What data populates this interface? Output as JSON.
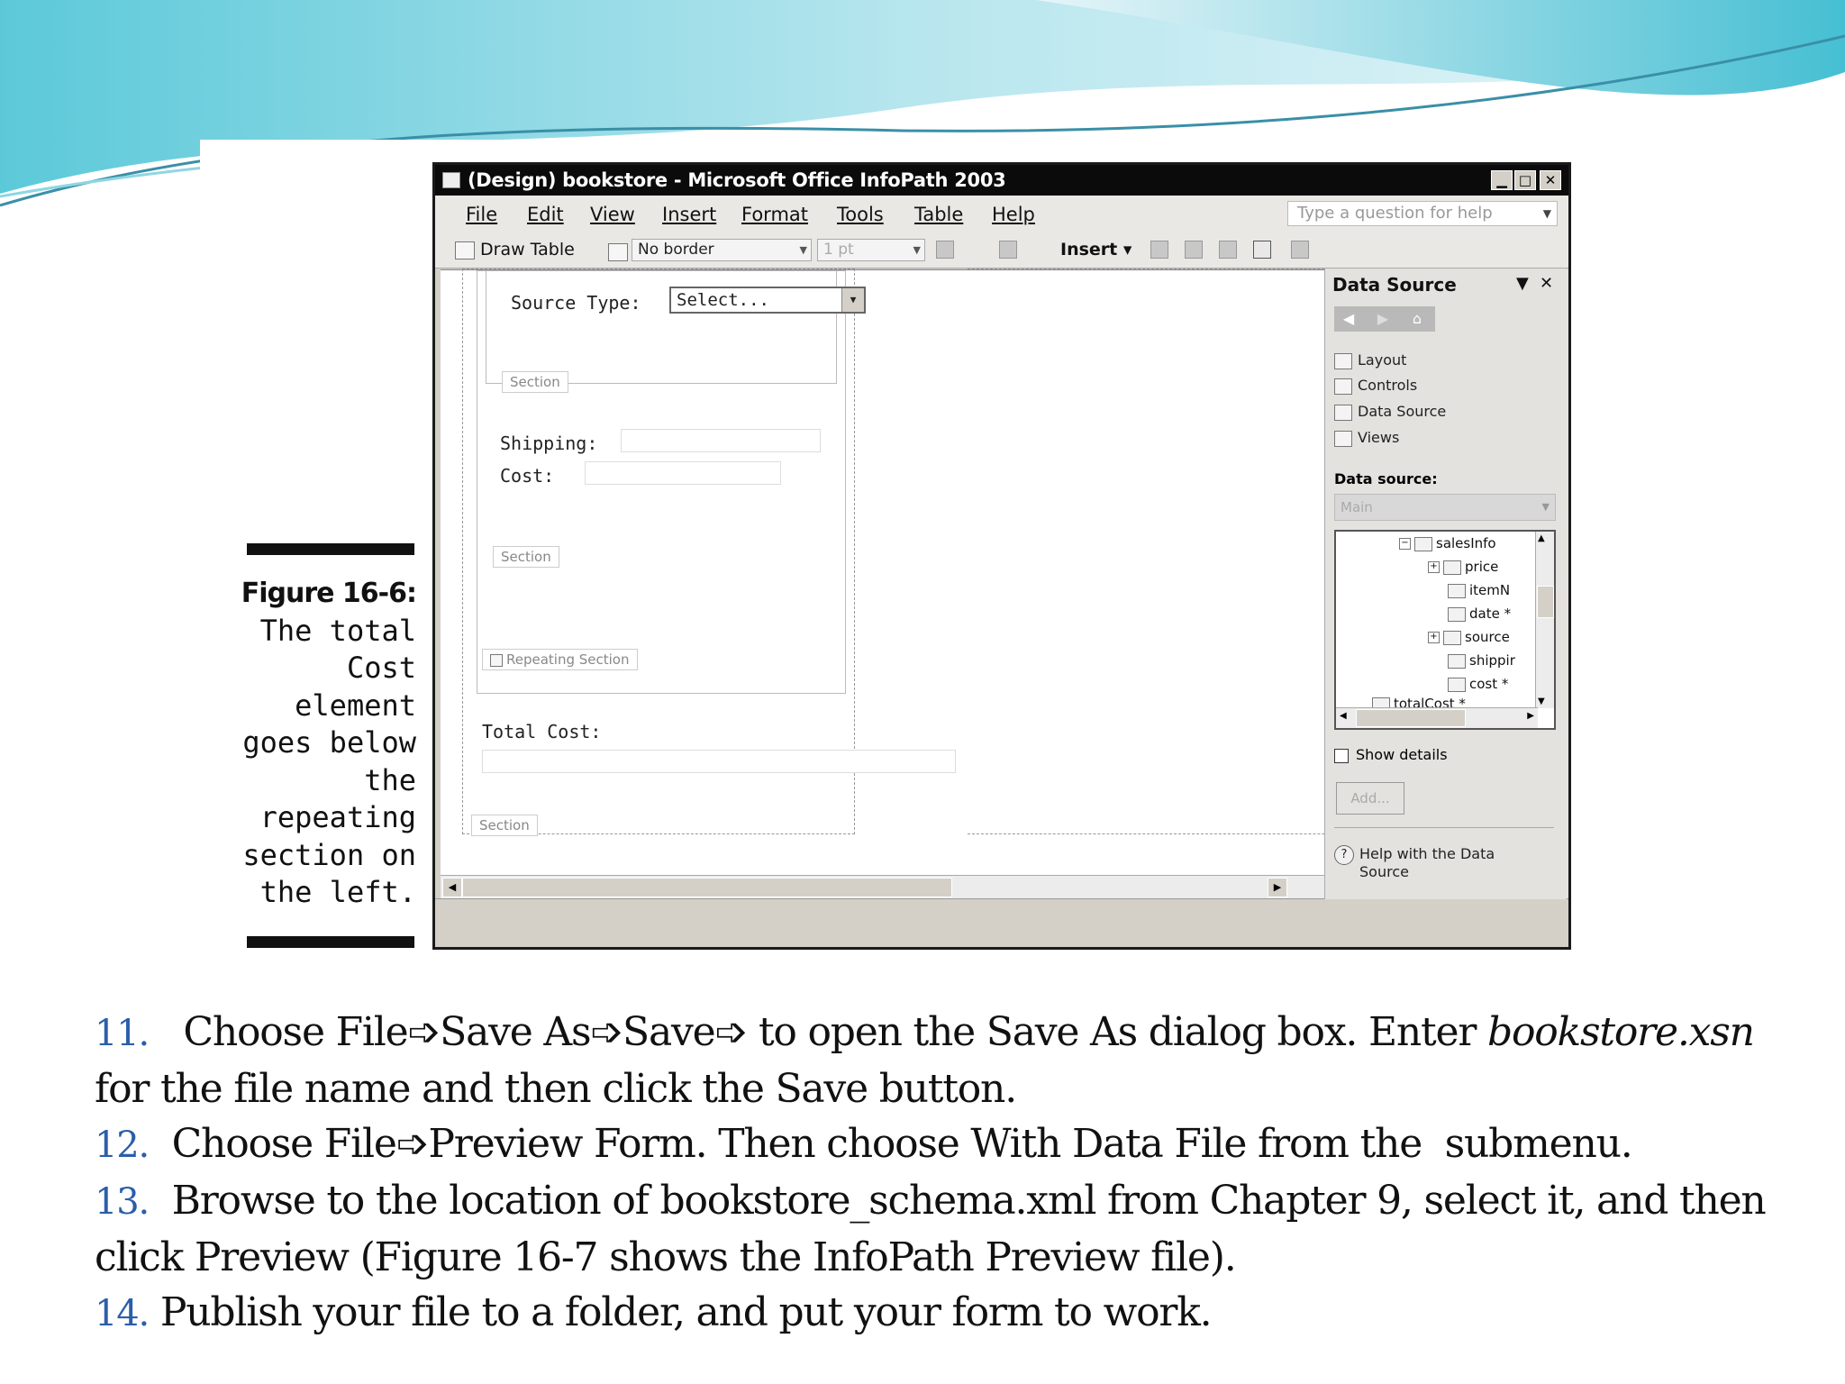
{
  "window": {
    "title": "(Design) bookstore - Microsoft Office InfoPath 2003"
  },
  "menus": [
    "File",
    "Edit",
    "View",
    "Insert",
    "Format",
    "Tools",
    "Table",
    "Help"
  ],
  "help_box": {
    "placeholder": "Type a question for help"
  },
  "toolbar": {
    "draw_table": "Draw Table",
    "border": "No border",
    "width": "1 pt",
    "insert": "Insert"
  },
  "form": {
    "source_type_label": "Source Type:",
    "source_type_value": "Select...",
    "section_tag": "Section",
    "shipping_label": "Shipping:",
    "cost_label": "Cost:",
    "repeating_section_tag": "Repeating Section",
    "total_cost_label": "Total Cost:"
  },
  "task_pane": {
    "title": "Data Source",
    "links": [
      "Layout",
      "Controls",
      "Data Source",
      "Views"
    ],
    "data_source_label": "Data source:",
    "data_source_value": "Main",
    "tree": [
      {
        "label": "salesInfo",
        "level": 0,
        "expander": "minus"
      },
      {
        "label": "price",
        "level": 1,
        "expander": "plus"
      },
      {
        "label": "itemN",
        "level": 2,
        "expander": ""
      },
      {
        "label": "date *",
        "level": 2,
        "expander": ""
      },
      {
        "label": "source",
        "level": 1,
        "expander": "plus"
      },
      {
        "label": "shippir",
        "level": 2,
        "expander": ""
      },
      {
        "label": "cost *",
        "level": 2,
        "expander": ""
      },
      {
        "label": "totalCost *",
        "level": 0,
        "expander": ""
      }
    ],
    "show_details": "Show details",
    "add_button": "Add...",
    "help_link": "Help with the Data Source"
  },
  "caption": {
    "title": "Figure 16-6:",
    "lines": [
      "The total",
      "Cost",
      "element",
      "goes below",
      "the",
      "repeating",
      "section on",
      "the left."
    ]
  },
  "steps": [
    {
      "num": "11.",
      "html": "Choose File&#x27A9;Save As&#x27A9;Save&#x27A9; to open the Save As dialog box. Enter <i>bookstore.xsn</i> for the file name and then click the Save button."
    },
    {
      "num": "12.",
      "html": "Choose File&#x27A9;Preview Form. Then choose With Data File from the &nbsp;submenu."
    },
    {
      "num": "13.",
      "html": "Browse to the location of bookstore_schema.xml from Chapter 9, select it, and then click Preview (Figure 16-7 shows the InfoPath Preview file)."
    },
    {
      "num": "14.",
      "html": "Publish your file to a folder, and put your form to work."
    }
  ],
  "colors": {
    "accent": "#2b5eaa",
    "wave_light": "#bfe8ef",
    "wave_dark": "#4cc3d6"
  }
}
